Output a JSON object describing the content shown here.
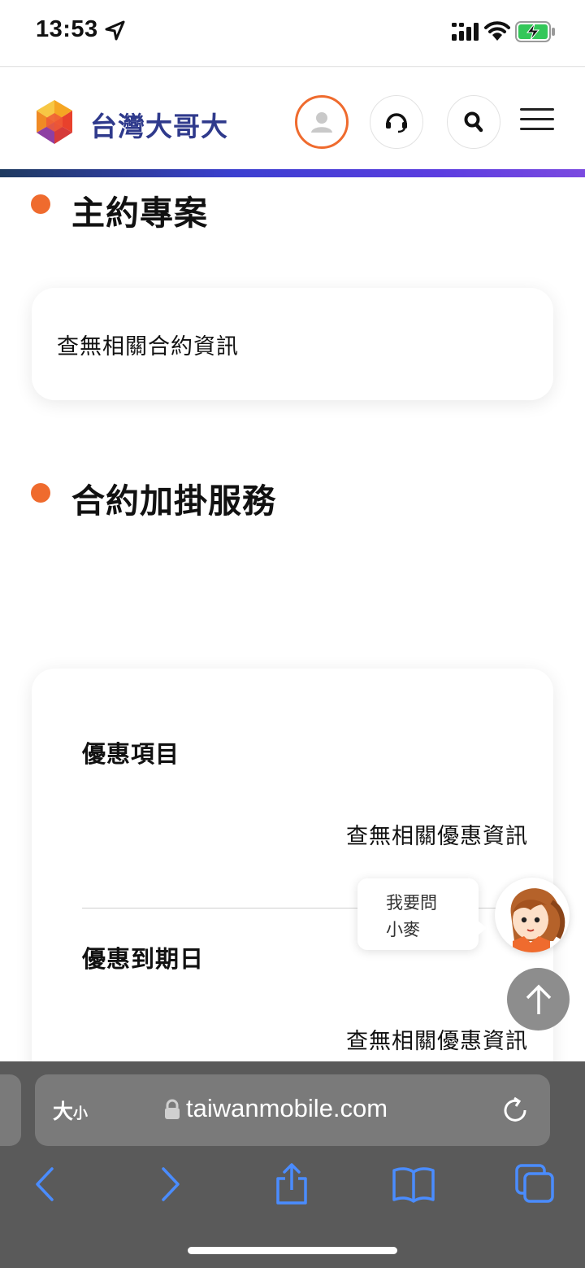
{
  "status_bar": {
    "time": "13:53"
  },
  "header": {
    "brand_name": "台灣大哥大",
    "accent_color": "#ef6b2e",
    "brand_color": "#2f3a8c"
  },
  "main": {
    "contract_section": {
      "title": "主約專案",
      "empty_text": "查無相關合約資訊"
    },
    "addon_section": {
      "title": "合約加掛服務",
      "items": [
        {
          "label": "優惠項目",
          "value": "查無相關優惠資訊"
        },
        {
          "label": "優惠到期日",
          "value": "查無相關優惠資訊"
        }
      ]
    }
  },
  "chat": {
    "line1": "我要問",
    "line2": "小麥"
  },
  "browser": {
    "text_size_big": "大",
    "text_size_small": "小",
    "url": "taiwanmobile.com"
  }
}
